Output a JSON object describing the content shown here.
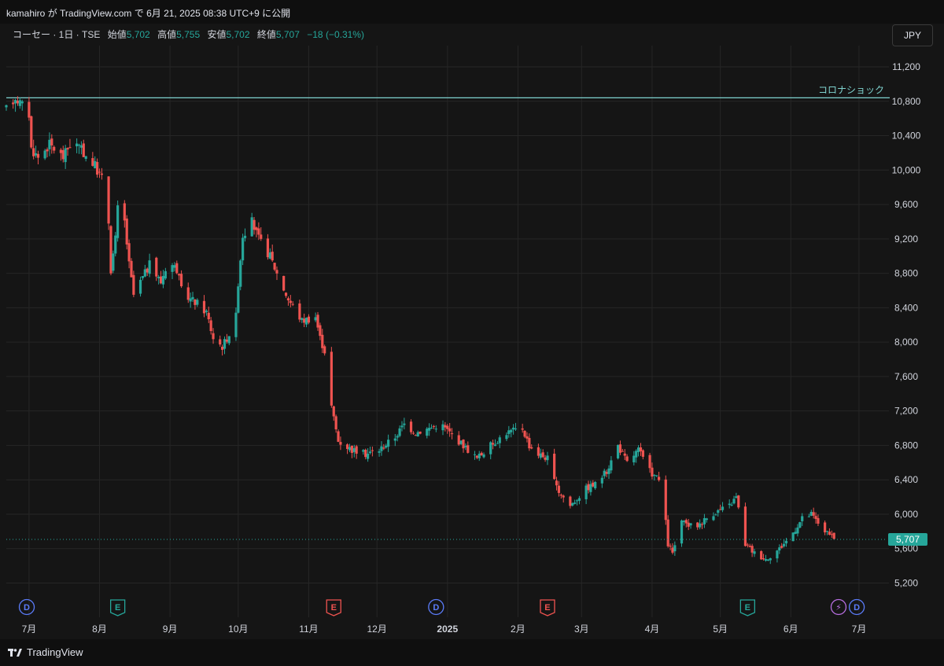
{
  "header": {
    "published_text": "kamahiro が TradingView.com で 6月 21, 2025 08:38 UTC+9 に公開"
  },
  "legend": {
    "symbol": "コーセー · 1日 · TSE",
    "open_label": "始値",
    "open": "5,702",
    "high_label": "高値",
    "high": "5,755",
    "low_label": "安値",
    "low": "5,702",
    "close_label": "終値",
    "close": "5,707",
    "change": "−18 (−0.31%)"
  },
  "currency": "JPY",
  "footer": {
    "brand": "TradingView"
  },
  "colors": {
    "up": "#26a69a",
    "down": "#ef5350",
    "background": "#151515",
    "grid": "#262626",
    "hline": "#7fd3cf"
  },
  "chart_data": {
    "type": "candlestick",
    "title": "",
    "ylim": [
      5000,
      11500
    ],
    "y_ticks": [
      {
        "value": 11200,
        "label": "11,200"
      },
      {
        "value": 10800,
        "label": "10,800"
      },
      {
        "value": 10400,
        "label": "10,400"
      },
      {
        "value": 10000,
        "label": "10,000"
      },
      {
        "value": 9600,
        "label": "9,600"
      },
      {
        "value": 9200,
        "label": "9,200"
      },
      {
        "value": 8800,
        "label": "8,800"
      },
      {
        "value": 8400,
        "label": "8,400"
      },
      {
        "value": 8000,
        "label": "8,000"
      },
      {
        "value": 7600,
        "label": "7,600"
      },
      {
        "value": 7200,
        "label": "7,200"
      },
      {
        "value": 6800,
        "label": "6,800"
      },
      {
        "value": 6400,
        "label": "6,400"
      },
      {
        "value": 6000,
        "label": "6,000"
      },
      {
        "value": 5600,
        "label": "5,600"
      },
      {
        "value": 5200,
        "label": "5,200"
      }
    ],
    "x_ticks": [
      {
        "date": "2024-07-01",
        "label": "7月",
        "bold": false
      },
      {
        "date": "2024-08-01",
        "label": "8月",
        "bold": false
      },
      {
        "date": "2024-09-01",
        "label": "9月",
        "bold": false
      },
      {
        "date": "2024-10-01",
        "label": "10月",
        "bold": false
      },
      {
        "date": "2024-11-01",
        "label": "11月",
        "bold": false
      },
      {
        "date": "2024-12-01",
        "label": "12月",
        "bold": false
      },
      {
        "date": "2025-01-01",
        "label": "2025",
        "bold": true
      },
      {
        "date": "2025-02-01",
        "label": "2月",
        "bold": false
      },
      {
        "date": "2025-03-01",
        "label": "3月",
        "bold": false
      },
      {
        "date": "2025-04-01",
        "label": "4月",
        "bold": false
      },
      {
        "date": "2025-05-01",
        "label": "5月",
        "bold": false
      },
      {
        "date": "2025-06-01",
        "label": "6月",
        "bold": false
      },
      {
        "date": "2025-07-01",
        "label": "7月",
        "bold": false
      }
    ],
    "horizontal_line": {
      "value": 10840,
      "label": "コロナショック"
    },
    "last_price": {
      "value": 5707,
      "label": "5,707"
    },
    "path_points": [
      [
        "2024-06-21",
        10700
      ],
      [
        "2024-06-25",
        10850
      ],
      [
        "2024-07-01",
        10650
      ],
      [
        "2024-07-02",
        10250
      ],
      [
        "2024-07-05",
        10150
      ],
      [
        "2024-07-10",
        10300
      ],
      [
        "2024-07-16",
        10150
      ],
      [
        "2024-07-20",
        10350
      ],
      [
        "2024-07-25",
        10200
      ],
      [
        "2024-07-30",
        10050
      ],
      [
        "2024-08-02",
        9900
      ],
      [
        "2024-08-05",
        9400
      ],
      [
        "2024-08-06",
        8850
      ],
      [
        "2024-08-08",
        9200
      ],
      [
        "2024-08-10",
        9900
      ],
      [
        "2024-08-14",
        8900
      ],
      [
        "2024-08-16",
        8550
      ],
      [
        "2024-08-19",
        8700
      ],
      [
        "2024-08-23",
        8900
      ],
      [
        "2024-08-28",
        8700
      ],
      [
        "2024-08-31",
        8950
      ],
      [
        "2024-09-04",
        8850
      ],
      [
        "2024-09-06",
        8600
      ],
      [
        "2024-09-10",
        8500
      ],
      [
        "2024-09-13",
        8450
      ],
      [
        "2024-09-17",
        8350
      ],
      [
        "2024-09-20",
        8050
      ],
      [
        "2024-09-24",
        7950
      ],
      [
        "2024-09-27",
        8100
      ],
      [
        "2024-09-30",
        8300
      ],
      [
        "2024-10-01",
        8700
      ],
      [
        "2024-10-03",
        9250
      ],
      [
        "2024-10-07",
        9400
      ],
      [
        "2024-10-10",
        9200
      ],
      [
        "2024-10-15",
        9000
      ],
      [
        "2024-10-18",
        8800
      ],
      [
        "2024-10-23",
        8500
      ],
      [
        "2024-10-29",
        8250
      ],
      [
        "2024-11-04",
        8300
      ],
      [
        "2024-11-06",
        8050
      ],
      [
        "2024-11-10",
        7750
      ],
      [
        "2024-11-11",
        7250
      ],
      [
        "2024-11-14",
        6850
      ],
      [
        "2024-11-20",
        6750
      ],
      [
        "2024-11-26",
        6700
      ],
      [
        "2024-12-02",
        6750
      ],
      [
        "2024-12-09",
        6900
      ],
      [
        "2024-12-13",
        7050
      ],
      [
        "2024-12-18",
        6950
      ],
      [
        "2024-12-24",
        7000
      ],
      [
        "2024-12-29",
        7050
      ],
      [
        "2025-01-06",
        6850
      ],
      [
        "2025-01-10",
        6750
      ],
      [
        "2025-01-14",
        6650
      ],
      [
        "2025-01-20",
        6800
      ],
      [
        "2025-01-27",
        6950
      ],
      [
        "2025-02-03",
        7000
      ],
      [
        "2025-02-06",
        6800
      ],
      [
        "2025-02-10",
        6700
      ],
      [
        "2025-02-14",
        6650
      ],
      [
        "2025-02-18",
        6300
      ],
      [
        "2025-02-24",
        6100
      ],
      [
        "2025-03-03",
        6300
      ],
      [
        "2025-03-07",
        6350
      ],
      [
        "2025-03-12",
        6500
      ],
      [
        "2025-03-17",
        6800
      ],
      [
        "2025-03-21",
        6600
      ],
      [
        "2025-03-26",
        6750
      ],
      [
        "2025-03-31",
        6500
      ],
      [
        "2025-04-04",
        6400
      ],
      [
        "2025-04-07",
        5900
      ],
      [
        "2025-04-08",
        5650
      ],
      [
        "2025-04-10",
        5550
      ],
      [
        "2025-04-14",
        5900
      ],
      [
        "2025-04-20",
        5850
      ],
      [
        "2025-04-27",
        6000
      ],
      [
        "2025-05-05",
        6100
      ],
      [
        "2025-05-08",
        6200
      ],
      [
        "2025-05-12",
        5650
      ],
      [
        "2025-05-16",
        5550
      ],
      [
        "2025-05-21",
        5480
      ],
      [
        "2025-05-27",
        5600
      ],
      [
        "2025-06-01",
        5750
      ],
      [
        "2025-06-06",
        5950
      ],
      [
        "2025-06-10",
        6000
      ],
      [
        "2025-06-13",
        5900
      ],
      [
        "2025-06-17",
        5780
      ],
      [
        "2025-06-20",
        5707
      ]
    ],
    "gaps": [
      [
        "2024-05-16",
        "2024-05-25"
      ]
    ],
    "date_range": [
      "2024-06-21",
      "2025-06-20"
    ],
    "x_axis_extent": [
      "2024-06-21",
      "2025-07-10"
    ],
    "events": [
      {
        "date": "2024-06-30",
        "letter": "D",
        "kind": "dividend"
      },
      {
        "date": "2024-08-09",
        "letter": "E",
        "kind": "earnings-up"
      },
      {
        "date": "2024-11-12",
        "letter": "E",
        "kind": "earnings-down"
      },
      {
        "date": "2024-12-27",
        "letter": "D",
        "kind": "dividend"
      },
      {
        "date": "2025-02-14",
        "letter": "E",
        "kind": "earnings-down"
      },
      {
        "date": "2025-05-13",
        "letter": "E",
        "kind": "earnings-up"
      },
      {
        "date": "2025-06-22",
        "letter": "⚡",
        "kind": "split"
      },
      {
        "date": "2025-06-30",
        "letter": "D",
        "kind": "dividend"
      }
    ]
  }
}
